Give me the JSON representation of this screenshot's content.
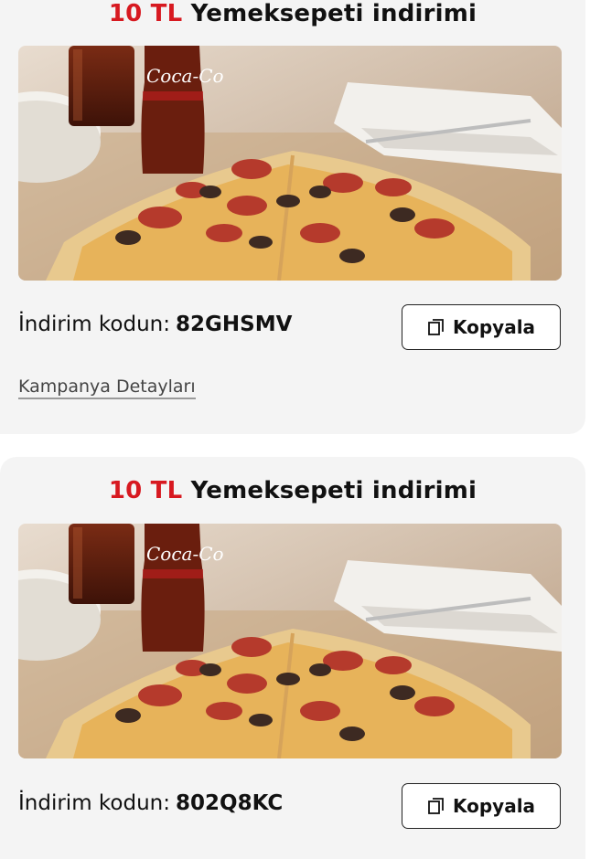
{
  "coupons": [
    {
      "amount": "10 TL",
      "title_rest": "Yemeksepeti indirimi",
      "code_label": "İndirim kodun:",
      "code": "82GHSMV",
      "copy_label": "Kopyala",
      "details_link": "Kampanya Detayları",
      "photo_brand_text": "Coca-Cola"
    },
    {
      "amount": "10 TL",
      "title_rest": "Yemeksepeti indirimi",
      "code_label": "İndirim kodun:",
      "code": "802Q8KC",
      "copy_label": "Kopyala",
      "photo_brand_text": "Coca-Cola"
    }
  ],
  "colors": {
    "accent_red": "#d71920",
    "card_bg": "#f4f4f4",
    "text": "#111111"
  },
  "icons": {
    "copy": "copy-icon"
  }
}
